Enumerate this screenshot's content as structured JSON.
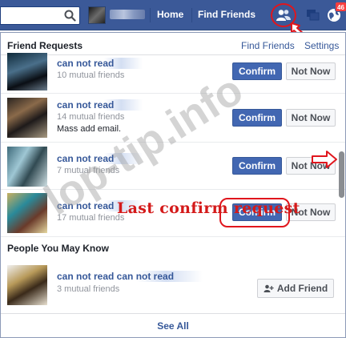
{
  "topbar": {
    "home": "Home",
    "find_friends": "Find Friends",
    "notification_count": "46"
  },
  "friend_requests": {
    "title": "Friend Requests",
    "find_friends_link": "Find Friends",
    "settings_link": "Settings",
    "requests": [
      {
        "name": "can not read",
        "mutual": "10 mutual friends",
        "extra": ""
      },
      {
        "name": "can not read",
        "mutual": "14 mutual friends",
        "extra": "Mass add email."
      },
      {
        "name": "can not read",
        "mutual": "7 mutual friends",
        "extra": ""
      },
      {
        "name": "can not read",
        "mutual": "17 mutual friends",
        "extra": ""
      }
    ],
    "confirm_label": "Confirm",
    "not_now_label": "Not Now"
  },
  "pymk": {
    "title": "People You May Know",
    "person": {
      "name": "can not read   can not read",
      "mutual": "3 mutual friends"
    },
    "add_friend_label": "Add Friend"
  },
  "annotation": "Last confirm request",
  "see_all": "See All",
  "watermark": "lop-tip.info",
  "colors": {
    "topbar": "#3b5998",
    "confirm": "#4267b2",
    "annotation": "#d41a1a"
  }
}
